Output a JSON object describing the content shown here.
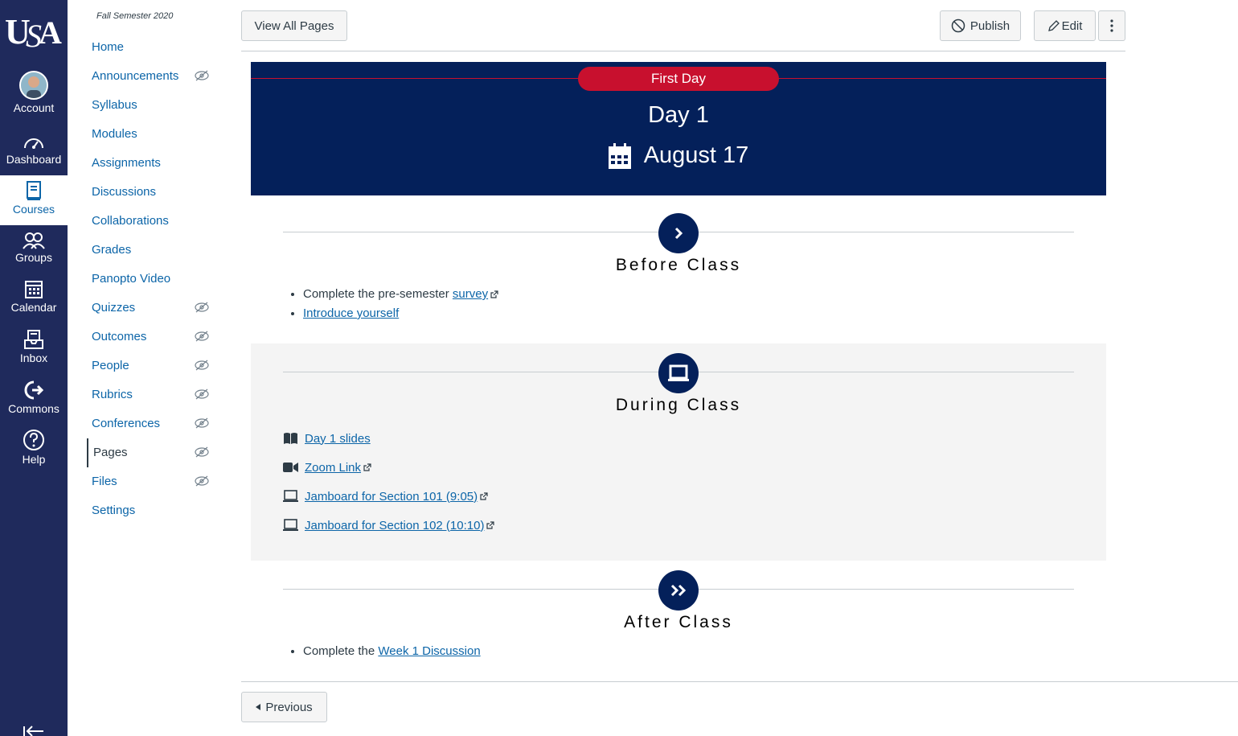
{
  "global_nav": {
    "logo_text": "USA",
    "items": [
      {
        "label": "Account",
        "icon": "avatar"
      },
      {
        "label": "Dashboard",
        "icon": "dashboard-icon"
      },
      {
        "label": "Courses",
        "icon": "courses-icon",
        "active": true
      },
      {
        "label": "Groups",
        "icon": "groups-icon"
      },
      {
        "label": "Calendar",
        "icon": "calendar-icon"
      },
      {
        "label": "Inbox",
        "icon": "inbox-icon"
      },
      {
        "label": "Commons",
        "icon": "commons-icon"
      },
      {
        "label": "Help",
        "icon": "help-icon"
      }
    ]
  },
  "course_nav": {
    "term": "Fall Semester 2020",
    "items": [
      {
        "label": "Home",
        "hidden": false
      },
      {
        "label": "Announcements",
        "hidden": true
      },
      {
        "label": "Syllabus",
        "hidden": false
      },
      {
        "label": "Modules",
        "hidden": false
      },
      {
        "label": "Assignments",
        "hidden": false
      },
      {
        "label": "Discussions",
        "hidden": false
      },
      {
        "label": "Collaborations",
        "hidden": false
      },
      {
        "label": "Grades",
        "hidden": false
      },
      {
        "label": "Panopto Video",
        "hidden": false
      },
      {
        "label": "Quizzes",
        "hidden": true
      },
      {
        "label": "Outcomes",
        "hidden": true
      },
      {
        "label": "People",
        "hidden": true
      },
      {
        "label": "Rubrics",
        "hidden": true
      },
      {
        "label": "Conferences",
        "hidden": true
      },
      {
        "label": "Pages",
        "hidden": true,
        "active": true
      },
      {
        "label": "Files",
        "hidden": true
      },
      {
        "label": "Settings",
        "hidden": false
      }
    ]
  },
  "toolbar": {
    "view_all": "View All Pages",
    "publish": "Publish",
    "edit": "Edit"
  },
  "banner": {
    "pill": "First Day",
    "day": "Day 1",
    "date": "August 17"
  },
  "before": {
    "title": "Before Class",
    "item1_prefix": "Complete the pre-semester ",
    "item1_link": "survey",
    "item2_link": "Introduce yourself"
  },
  "during": {
    "title": "During Class",
    "resources": [
      {
        "label": "Day 1 slides",
        "icon": "book-icon",
        "external": false
      },
      {
        "label": "Zoom Link",
        "icon": "video-icon",
        "external": true
      },
      {
        "label": "Jamboard for Section 101 (9:05)",
        "icon": "laptop-icon",
        "external": true
      },
      {
        "label": "Jamboard for Section 102 (10:10)",
        "icon": "laptop-icon",
        "external": true
      }
    ]
  },
  "after": {
    "title": "After Class",
    "item1_prefix": "Complete the ",
    "item1_link": "Week 1 Discussion"
  },
  "footer": {
    "previous": "Previous"
  },
  "colors": {
    "nav_bg": "#1f2a5c",
    "banner_bg": "#04205a",
    "accent_red": "#c8102e",
    "link": "#0c65a8"
  }
}
